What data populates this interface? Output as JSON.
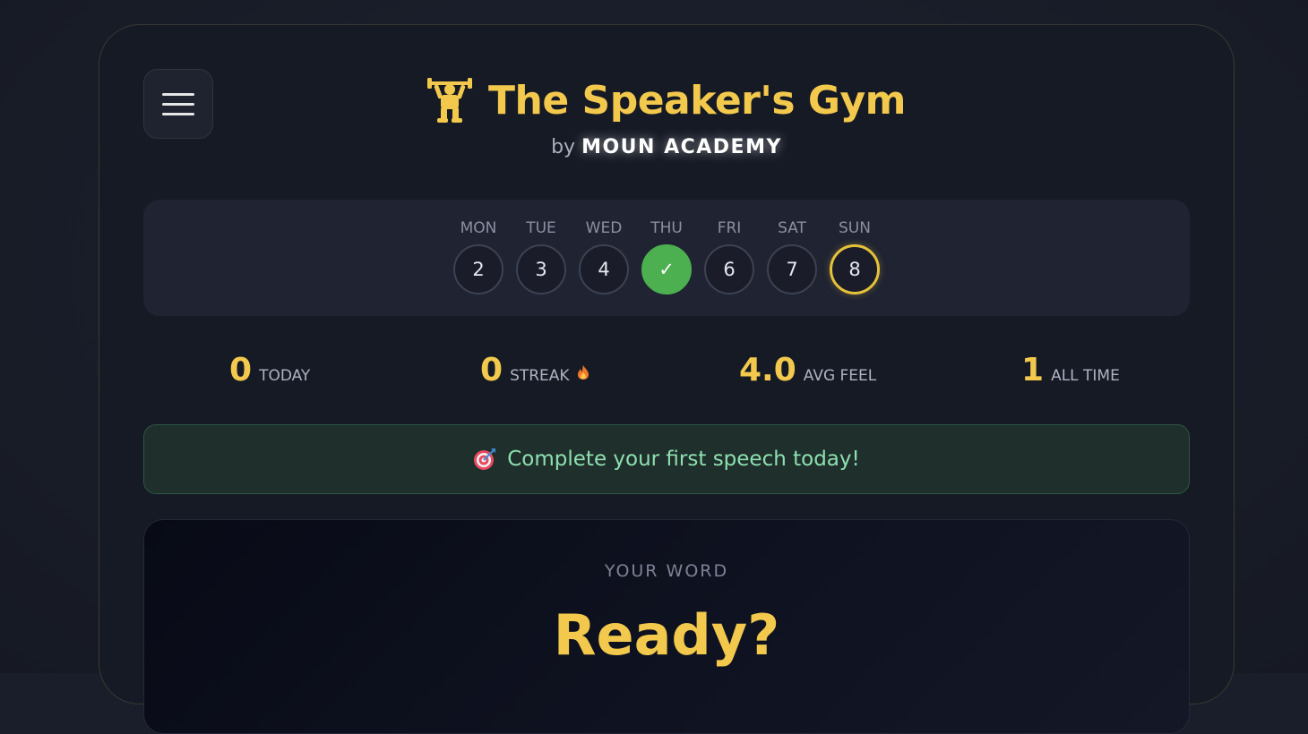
{
  "header": {
    "title": "The Speaker's Gym",
    "by_prefix": "by",
    "brand": "MOUN ACADEMY",
    "icon": "weightlifter-icon",
    "menu_icon": "hamburger-menu-icon"
  },
  "week": {
    "days": [
      {
        "name": "MON",
        "date": "2",
        "state": "default"
      },
      {
        "name": "TUE",
        "date": "3",
        "state": "default"
      },
      {
        "name": "WED",
        "date": "4",
        "state": "default"
      },
      {
        "name": "THU",
        "date": "✓",
        "state": "done"
      },
      {
        "name": "FRI",
        "date": "6",
        "state": "default"
      },
      {
        "name": "SAT",
        "date": "7",
        "state": "default"
      },
      {
        "name": "SUN",
        "date": "8",
        "state": "current"
      }
    ]
  },
  "stats": {
    "today": {
      "value": "0",
      "label": "TODAY"
    },
    "streak": {
      "value": "0",
      "label": "STREAK",
      "icon": "fire-icon"
    },
    "avg_feel": {
      "value": "4.0",
      "label": "AVG FEEL"
    },
    "all_time": {
      "value": "1",
      "label": "ALL TIME"
    }
  },
  "banner": {
    "text": "Complete your first speech today!",
    "icon": "target-icon"
  },
  "word_card": {
    "label": "YOUR WORD",
    "word": "Ready?"
  },
  "colors": {
    "accent": "#f2c94c",
    "done": "#4caf50",
    "banner_text": "#8ee0b0"
  }
}
